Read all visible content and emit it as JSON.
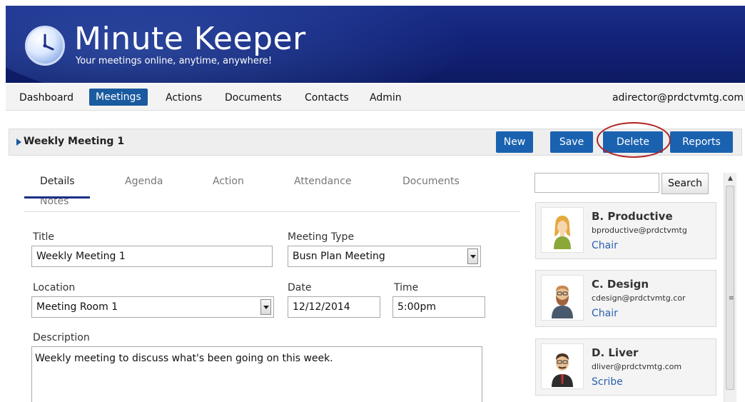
{
  "app": {
    "title": "Minute Keeper",
    "tagline": "Your meetings online, anytime, anywhere!"
  },
  "nav": {
    "items": [
      {
        "label": "Dashboard"
      },
      {
        "label": "Meetings",
        "active": true
      },
      {
        "label": "Actions"
      },
      {
        "label": "Documents"
      },
      {
        "label": "Contacts"
      },
      {
        "label": "Admin"
      }
    ],
    "user": "adirector@prdctvmtg.com"
  },
  "meeting": {
    "title": "Weekly Meeting 1"
  },
  "toolbar": {
    "new_label": "New",
    "save_label": "Save",
    "delete_label": "Delete",
    "reports_label": "Reports"
  },
  "tabs": [
    {
      "label": "Details",
      "active": true
    },
    {
      "label": "Agenda"
    },
    {
      "label": "Action"
    },
    {
      "label": "Attendance"
    },
    {
      "label": "Documents"
    },
    {
      "label": "Notes"
    }
  ],
  "form": {
    "title_label": "Title",
    "title_value": "Weekly Meeting 1",
    "meeting_type_label": "Meeting Type",
    "meeting_type_value": "Busn Plan Meeting",
    "location_label": "Location",
    "location_value": "Meeting Room 1",
    "date_label": "Date",
    "date_value": "12/12/2014",
    "time_label": "Time",
    "time_value": "5:00pm",
    "description_label": "Description",
    "description_value": "Weekly meeting to discuss what's been going on this week."
  },
  "search": {
    "button_label": "Search"
  },
  "contacts": [
    {
      "name": "B. Productive",
      "email": "bproductive@prdctvmtg",
      "role": "Chair"
    },
    {
      "name": "C. Design",
      "email": "cdesign@prdctvmtg.cor",
      "role": "Chair"
    },
    {
      "name": "D. Liver",
      "email": "dliver@prdctvmtg.com",
      "role": "Scribe"
    }
  ],
  "colors": {
    "header_blue": "#13237a",
    "button_blue": "#1a62b0",
    "highlight_circle": "#b02222",
    "link_blue": "#2a5fb0"
  }
}
